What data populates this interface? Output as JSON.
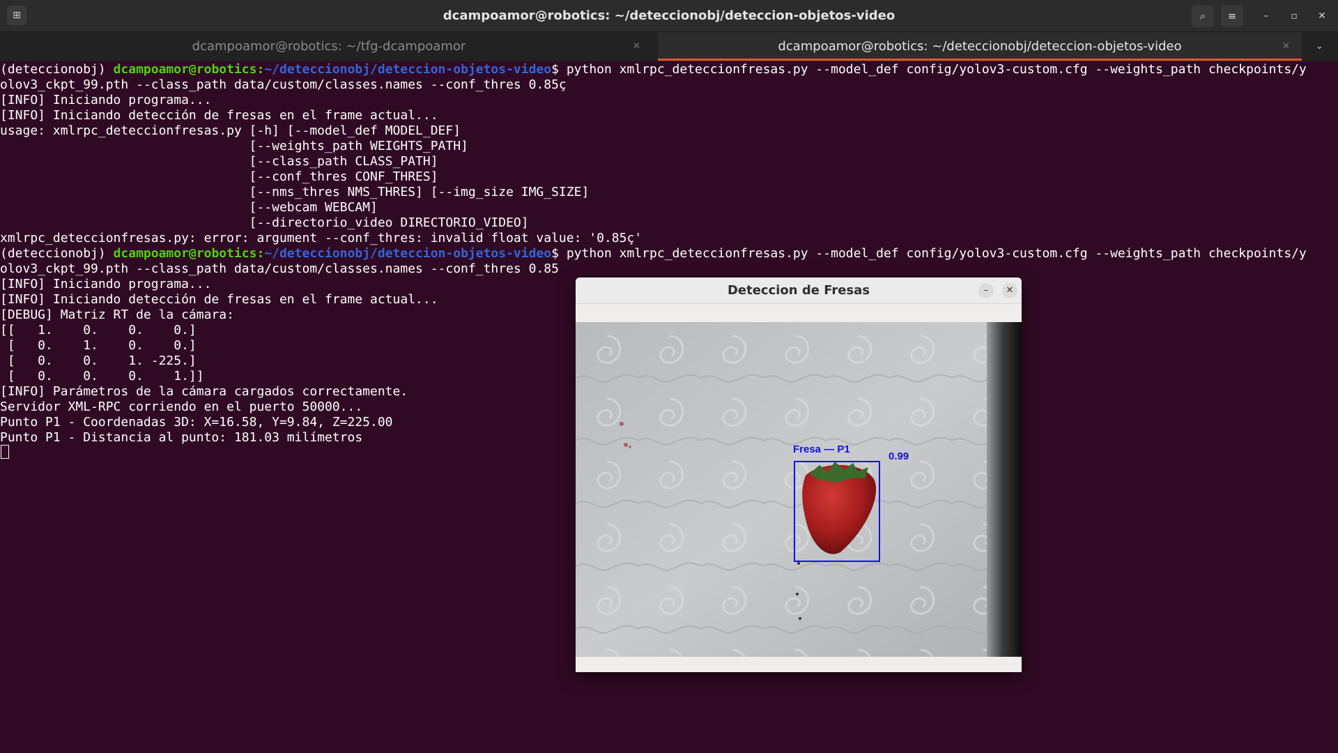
{
  "header": {
    "title": "dcampoamor@robotics: ~/deteccionobj/deteccion-objetos-video",
    "new_tab_icon": "⊞",
    "search_icon": "⌕",
    "menu_icon": "≡",
    "minimize_icon": "–",
    "maximize_icon": "▫",
    "close_icon": "✕"
  },
  "tabs": [
    {
      "label": "dcampoamor@robotics: ~/tfg-dcampoamor",
      "active": false,
      "close": "✕"
    },
    {
      "label": "dcampoamor@robotics: ~/deteccionobj/deteccion-objetos-video",
      "active": true,
      "close": "✕"
    }
  ],
  "tab_menu_icon": "⌄",
  "terminal": {
    "prompt1": {
      "env": "(deteccionobj) ",
      "user": "dcampoamor@robotics",
      "colon": ":",
      "path": "~/deteccionobj/deteccion-objetos-video",
      "dollar": "$ ",
      "cmd": "python xmlrpc_deteccionfresas.py --model_def config/yolov3-custom.cfg --weights_path checkpoints/y"
    },
    "line_2": "olov3_ckpt_99.pth --class_path data/custom/classes.names --conf_thres 0.85ç",
    "line_3": "[INFO] Iniciando programa...",
    "line_4": "[INFO] Iniciando detección de fresas en el frame actual...",
    "line_5": "usage: xmlrpc_deteccionfresas.py [-h] [--model_def MODEL_DEF]",
    "line_6": "                                 [--weights_path WEIGHTS_PATH]",
    "line_7": "                                 [--class_path CLASS_PATH]",
    "line_8": "                                 [--conf_thres CONF_THRES]",
    "line_9": "                                 [--nms_thres NMS_THRES] [--img_size IMG_SIZE]",
    "line_10": "                                 [--webcam WEBCAM]",
    "line_11": "                                 [--directorio_video DIRECTORIO_VIDEO]",
    "line_12": "xmlrpc_deteccionfresas.py: error: argument --conf_thres: invalid float value: '0.85ç'",
    "prompt2": {
      "env": "(deteccionobj) ",
      "user": "dcampoamor@robotics",
      "colon": ":",
      "path": "~/deteccionobj/deteccion-objetos-video",
      "dollar": "$ ",
      "cmd": "python xmlrpc_deteccionfresas.py --model_def config/yolov3-custom.cfg --weights_path checkpoints/y"
    },
    "line_14": "olov3_ckpt_99.pth --class_path data/custom/classes.names --conf_thres 0.85",
    "line_15": "[INFO] Iniciando programa...",
    "line_16": "[INFO] Iniciando detección de fresas en el frame actual...",
    "line_17": "[DEBUG] Matriz RT de la cámara:",
    "line_18": "[[   1.    0.    0.    0.]",
    "line_19": " [   0.    1.    0.    0.]",
    "line_20": " [   0.    0.    1. -225.]",
    "line_21": " [   0.    0.    0.    1.]]",
    "line_22": "[INFO] Parámetros de la cámara cargados correctamente.",
    "line_23": "Servidor XML-RPC corriendo en el puerto 50000...",
    "line_24": "Punto P1 - Coordenadas 3D: X=16.58, Y=9.84, Z=225.00",
    "line_25": "Punto P1 - Distancia al punto: 181.03 milímetros"
  },
  "cv_window": {
    "title": "Deteccion de Fresas",
    "minimize_icon": "–",
    "close_icon": "✕",
    "detection_label": "Fresa — P1",
    "detection_score": "0.99"
  },
  "colors": {
    "terminal_bg": "#300a24",
    "prompt_user": "#4fd20f",
    "prompt_path": "#3465d8",
    "active_tab_accent": "#e95420",
    "detection_box": "#1010e8"
  }
}
